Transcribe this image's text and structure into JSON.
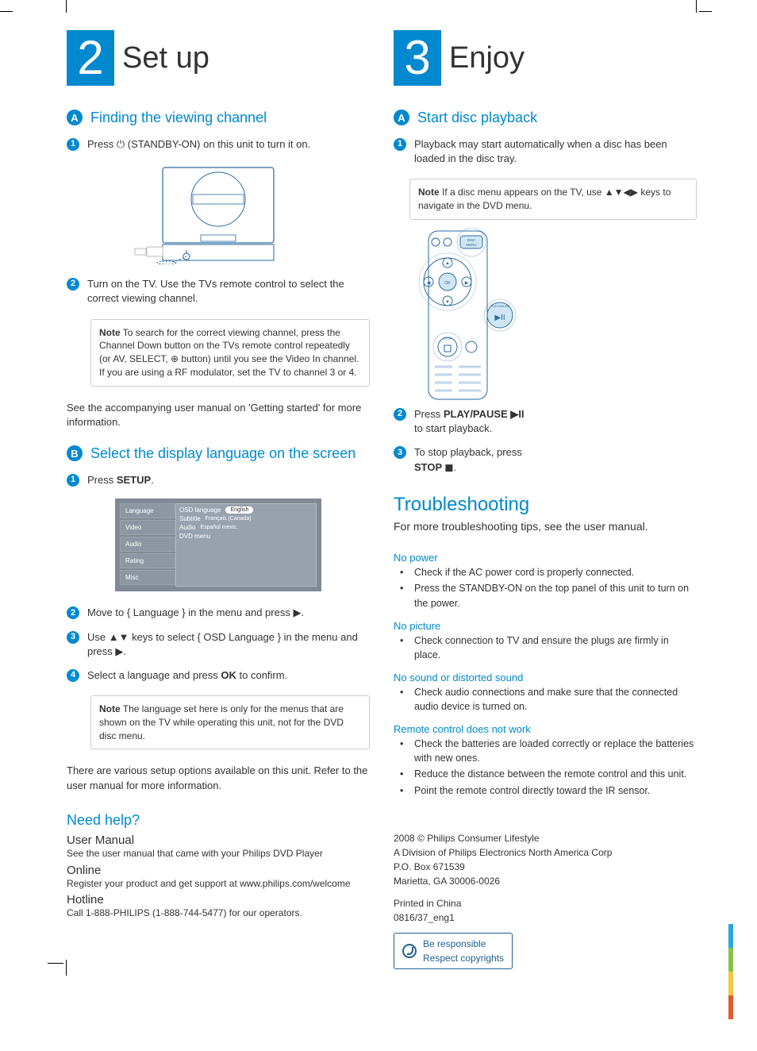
{
  "left": {
    "step_num": "2",
    "step_title": "Set up",
    "A": {
      "letter": "A",
      "title": "Finding the viewing channel",
      "s1_a": "Press ",
      "s1_b": " (STANDBY-ON) on this unit to turn it on.",
      "s2": "Turn on the TV. Use the TVs remote control to select the correct viewing channel.",
      "note_label": "Note",
      "note": "  To search for the correct viewing channel, press the Channel Down button on the TVs remote control repeatedly (or AV, SELECT, ⊕ button) until you see the Video In channel. If you are using a RF modulator, set the TV to channel 3 or 4.",
      "after": "See the accompanying user manual on 'Getting started' for more information."
    },
    "B": {
      "letter": "B",
      "title": "Select the display language on the screen",
      "s1_a": "Press ",
      "s1_b": "SETUP",
      "s1_c": ".",
      "menu": {
        "l1": "Language",
        "l2": "Video",
        "l3": "Audio",
        "l4": "Rating",
        "l5": "Misc",
        "r1": "OSD language",
        "r1v": "English",
        "r2": "Subtitle",
        "r2v": "Français (Canada)",
        "r3": "Audio",
        "r3v": "Español mexic.",
        "r4": "DVD menu"
      },
      "s2": "Move to { Language } in the menu and press ▶.",
      "s3": "Use ▲▼ keys to select { OSD Language } in the menu and press ▶.",
      "s4_a": "Select a language and press ",
      "s4_b": "OK",
      "s4_c": " to confirm.",
      "note_label": "Note",
      "note": "  The language set here is only for the menus that are shown on the TV while operating this unit, not for the DVD disc menu.",
      "after": "There are various setup options available on this unit. Refer to the user manual for more information."
    },
    "help": {
      "title": "Need help?",
      "h1": "User Manual",
      "t1": "See the user manual that came with your Philips DVD Player",
      "h2": "Online",
      "t2": "Register your product and get support at www.philips.com/welcome",
      "h3": "Hotline",
      "t3": "Call 1-888-PHILIPS (1-888-744-5477) for our operators."
    }
  },
  "right": {
    "step_num": "3",
    "step_title": "Enjoy",
    "A": {
      "letter": "A",
      "title": "Start disc playback",
      "s1": "Playback may start automatically when a disc has been loaded in the disc tray.",
      "note_label": "Note",
      "note": "  If a disc menu appears on the TV, use ▲▼◀▶ keys to navigate in the DVD menu.",
      "s2_a": "Press ",
      "s2_b": "PLAY/PAUSE ▶II",
      "s2_c": " to start playback.",
      "s3_a": "To stop playback, press ",
      "s3_b": "STOP ◼",
      "s3_c": ".",
      "remote": {
        "btn1": "DISC MENU",
        "btn2": "OK",
        "btn3": "PLAY/PAUSE",
        "btn4": "STOP"
      }
    },
    "trouble": {
      "title": "Troubleshooting",
      "sub": "For more troubleshooting tips, see the user manual.",
      "s1": "No power",
      "s1_i1": "Check if the AC power cord is properly connected.",
      "s1_i2": "Press the STANDBY-ON on the top panel of this unit to turn on the power.",
      "s2": "No picture",
      "s2_i1": "Check connection to TV and ensure the plugs are firmly in place.",
      "s3": "No sound or distorted sound",
      "s3_i1": "Check audio connections and make sure that the connected audio device is turned on.",
      "s4": "Remote control does not work",
      "s4_i1": "Check the batteries are loaded correctly or replace the batteries with new ones.",
      "s4_i2": "Reduce the distance between the remote control and this unit.",
      "s4_i3": "Point the remote control directly toward the IR sensor."
    },
    "legal": {
      "l1": "2008 © Philips Consumer Lifestyle",
      "l2": "A Division of Philips Electronics North America Corp",
      "l3": "P.O. Box 671539",
      "l4": "Marietta, GA 30006-0026",
      "l5": "Printed in China",
      "l6": "0816/37_eng1",
      "resp1": "Be responsible",
      "resp2": "Respect copyrights"
    }
  }
}
